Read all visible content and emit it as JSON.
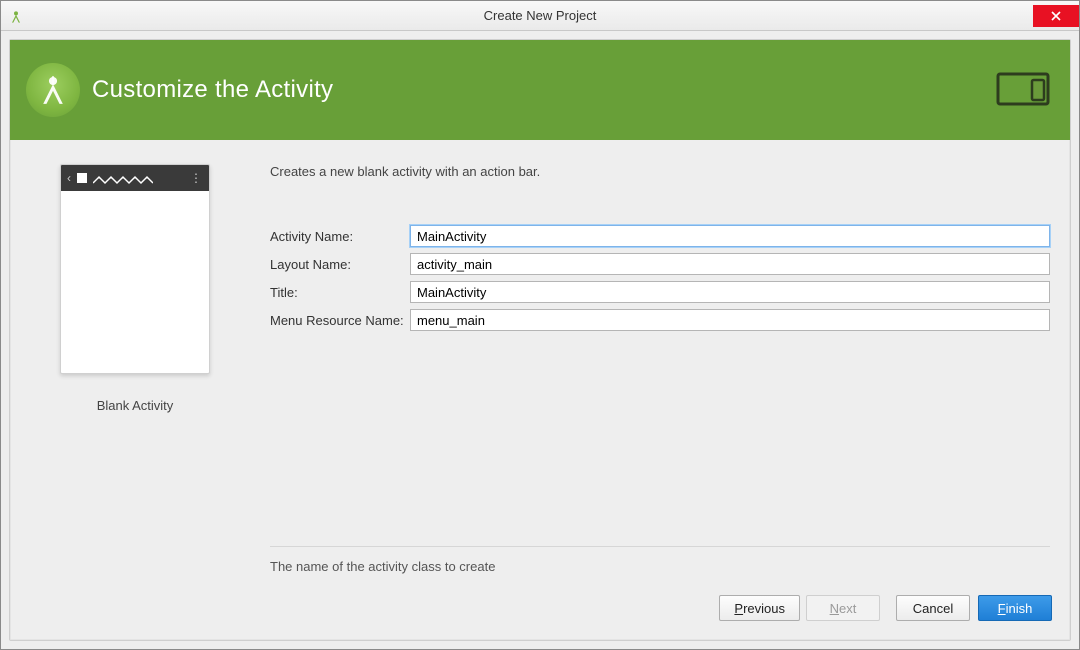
{
  "window": {
    "title": "Create New Project"
  },
  "hero": {
    "heading": "Customize the Activity"
  },
  "intro_text": "Creates a new blank activity with an action bar.",
  "preview_caption": "Blank Activity",
  "fields": {
    "activity_name": {
      "label": "Activity Name:",
      "value": "MainActivity"
    },
    "layout_name": {
      "label": "Layout Name:",
      "value": "activity_main"
    },
    "title": {
      "label": "Title:",
      "value": "MainActivity"
    },
    "menu_res": {
      "label": "Menu Resource Name:",
      "value": "menu_main"
    }
  },
  "hint_text": "The name of the activity class to create",
  "buttons": {
    "previous": "Previous",
    "next": "Next",
    "cancel": "Cancel",
    "finish": "Finish"
  }
}
